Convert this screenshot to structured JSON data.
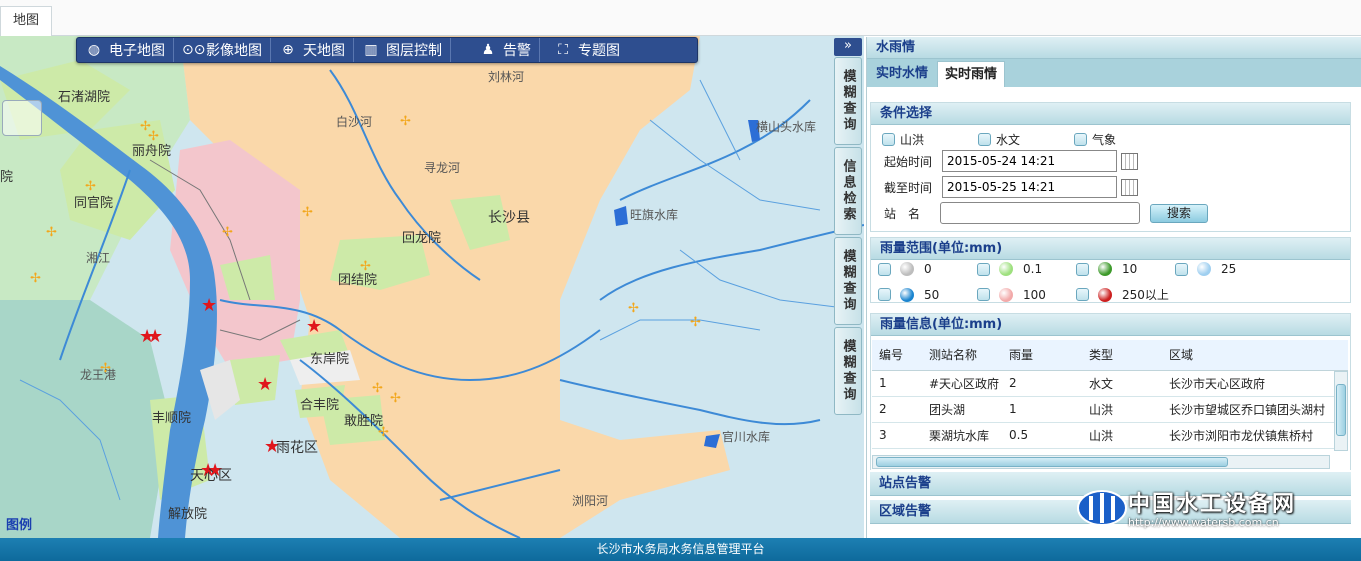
{
  "top_tab": "地图",
  "toolbar": [
    {
      "label": "电子地图",
      "icon": "globe-icon"
    },
    {
      "label": "影像地图",
      "icon": "tape-icon"
    },
    {
      "label": "天地图",
      "icon": "crosshair-icon"
    },
    {
      "label": "图层控制",
      "icon": "map-book-icon"
    },
    {
      "label": "告警",
      "icon": "user-alert-icon"
    },
    {
      "label": "专题图",
      "icon": "fullscreen-icon"
    }
  ],
  "collapse_label": "»",
  "side_tabs": [
    "模糊查询",
    "信息检索",
    "模糊查询",
    "模糊查询"
  ],
  "map_labels": {
    "shizhuhu": "石渚湖院",
    "lizhou": "丽舟院",
    "tongguan": "同官院",
    "xiangjiang": "湘江",
    "baishahe": "白沙河",
    "xunlonghe": "寻龙河",
    "changsha": "长沙县",
    "huilong": "回龙院",
    "tuanjie": "团结院",
    "dongan": "东岸院",
    "hehua": "合丰院",
    "gansheng": "敢胜院",
    "yuhua": "雨花区",
    "tianxin": "天心区",
    "fengshun": "丰顺院",
    "jiefang": "解放院",
    "longwang": "龙王港",
    "liulin": "刘林河",
    "hengshantou": "横山头水库",
    "wangqi": "旺旗水库",
    "guanchuan": "官川水库",
    "liuyanghe": "浏阳河",
    "right_edge": "院"
  },
  "legend_link": "图例",
  "panel_title": "水雨情",
  "tabs": [
    "实时水情",
    "实时雨情"
  ],
  "active_tab": 1,
  "condition": {
    "title": "条件选择",
    "checks": [
      "山洪",
      "水文",
      "气象"
    ],
    "start_label": "起始时间",
    "start_value": "2015-05-24 14:21",
    "end_label": "截至时间",
    "end_value": "2015-05-25 14:21",
    "station_label": "站　名",
    "station_value": "",
    "search_button": "搜索"
  },
  "rain_range": {
    "title": "雨量范围(单位:mm)",
    "items": [
      {
        "label": "0",
        "color": "#bdbdbd"
      },
      {
        "label": "0.1",
        "color": "#9ee07e"
      },
      {
        "label": "10",
        "color": "#3d9a2a"
      },
      {
        "label": "25",
        "color": "#9fcff0"
      },
      {
        "label": "50",
        "color": "#1a84cf"
      },
      {
        "label": "100",
        "color": "#f2a9a9"
      },
      {
        "label": "250以上",
        "color": "#cc1f1f"
      }
    ]
  },
  "rain_info": {
    "title": "雨量信息(单位:mm)",
    "headers": [
      "编号",
      "测站名称",
      "雨量",
      "类型",
      "区域"
    ],
    "rows": [
      [
        "1",
        "#天心区政府",
        "2",
        "水文",
        "长沙市天心区政府"
      ],
      [
        "2",
        "团头湖",
        "1",
        "山洪",
        "长沙市望城区乔口镇团头湖村"
      ],
      [
        "3",
        "栗湖坑水库",
        "0.5",
        "山洪",
        "长沙市浏阳市龙伏镇焦桥村"
      ]
    ]
  },
  "station_alarm": "站点告警",
  "area_alarm": "区域告警",
  "watermark": {
    "title": "中国水工设备网",
    "url": "http://www.watersb.com.cn"
  },
  "footer": "长沙市水务局水务信息管理平台"
}
